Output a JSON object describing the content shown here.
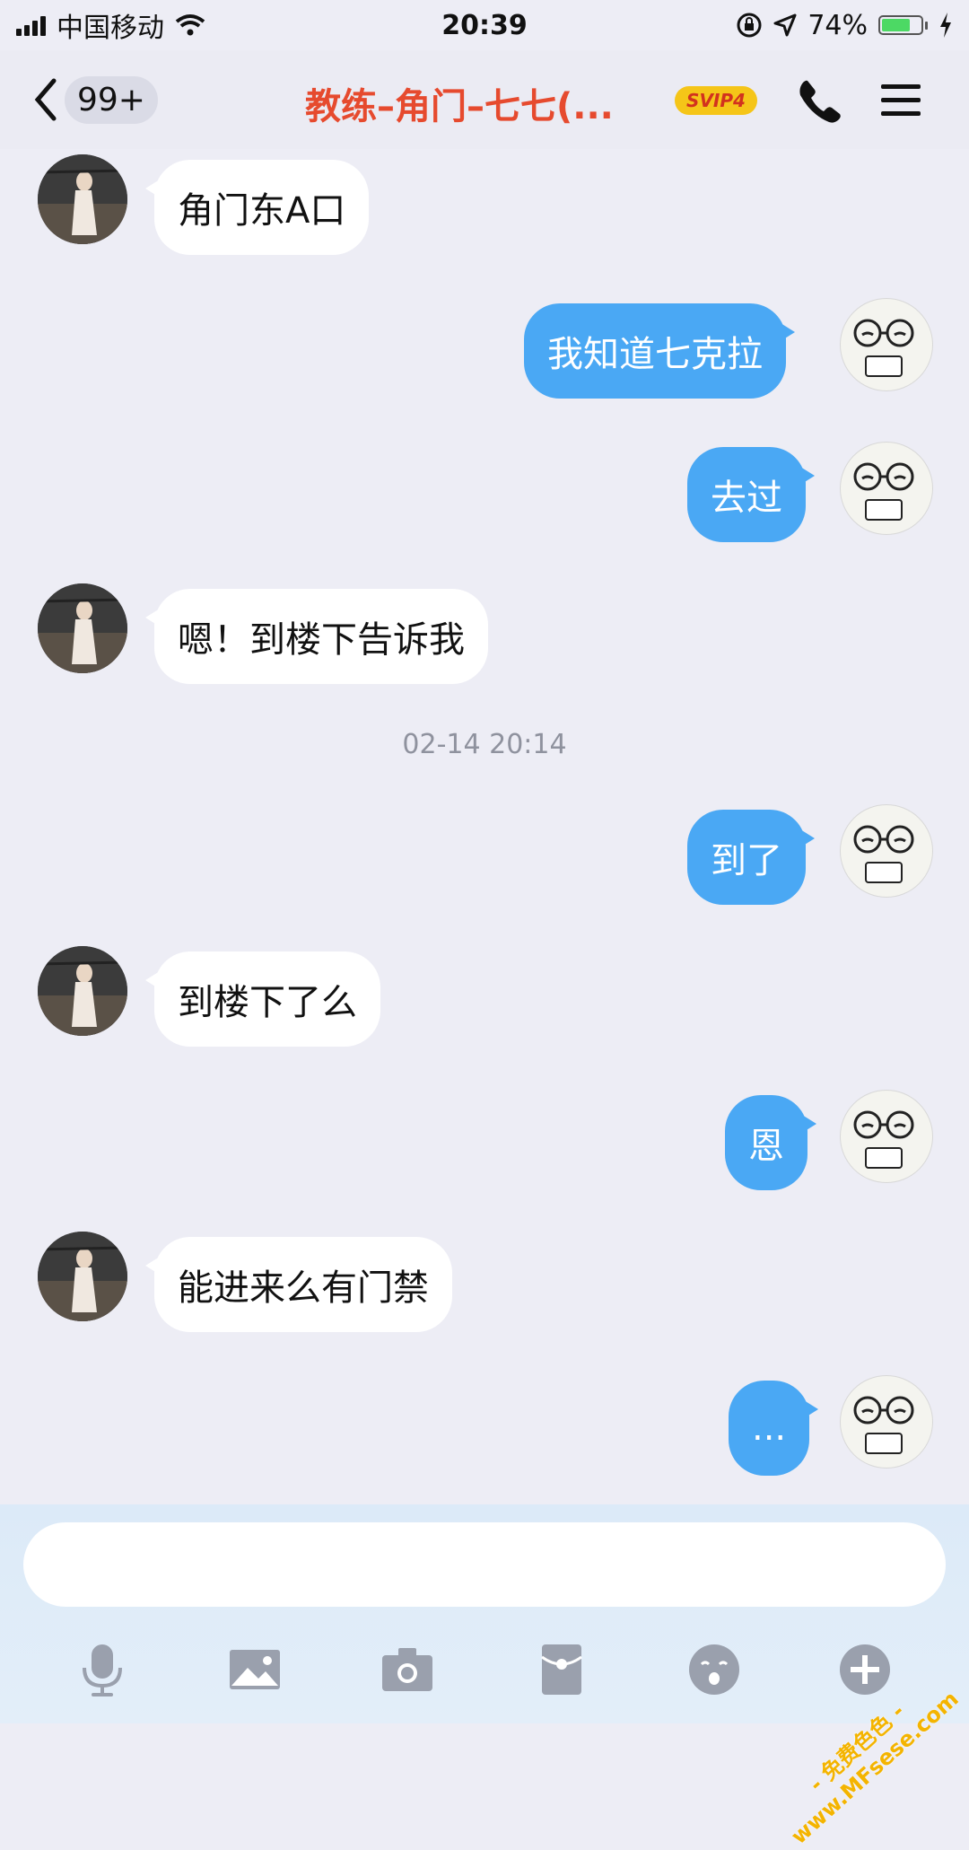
{
  "status_bar": {
    "carrier": "中国移动",
    "time": "20:39",
    "battery_percent": "74%",
    "battery_level": 0.74
  },
  "nav": {
    "unread_count": "99+",
    "title": "教练–角门–七七(...",
    "vip_badge": "SVIP4"
  },
  "messages": [
    {
      "side": "left",
      "text": "角门东A口"
    },
    {
      "side": "right",
      "text": "我知道七克拉"
    },
    {
      "side": "right",
      "text": "去过"
    },
    {
      "side": "left",
      "text": "嗯！到楼下告诉我"
    },
    {
      "timestamp": "02-14 20:14"
    },
    {
      "side": "right",
      "text": "到了"
    },
    {
      "side": "left",
      "text": "到楼下了么"
    },
    {
      "side": "right",
      "text": "恩"
    },
    {
      "side": "left",
      "text": "能进来么有门禁"
    },
    {
      "side": "right",
      "text": "..."
    }
  ],
  "input": {
    "value": "",
    "placeholder": ""
  },
  "toolbar": {
    "icons": [
      "microphone-icon",
      "image-icon",
      "camera-icon",
      "red-packet-icon",
      "emoji-icon",
      "plus-icon"
    ]
  },
  "watermark": {
    "line1": "- 免费色色 -",
    "line2": "www.MFsese.com"
  },
  "colors": {
    "sent_bubble": "#4aa8f4",
    "received_bubble": "#ffffff",
    "title": "#e64a2e",
    "background": "#ededf5"
  }
}
